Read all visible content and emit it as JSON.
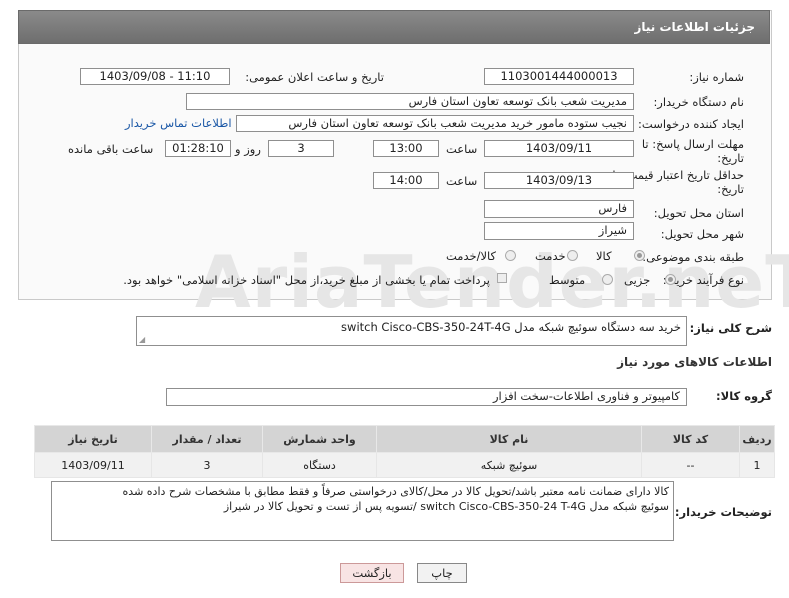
{
  "header": {
    "title": "جزئیات اطلاعات نیاز"
  },
  "form": {
    "need_number": {
      "label": "شماره نیاز:",
      "value": "1103001444000013"
    },
    "announce_datetime": {
      "label": "تاریخ و ساعت اعلان عمومی:",
      "value": "1403/09/08 - 11:10"
    },
    "buyer_org": {
      "label": "نام دستگاه خریدار:",
      "value": "مدیریت شعب بانک توسعه تعاون استان فارس"
    },
    "requester": {
      "label": "ایجاد کننده درخواست:",
      "value": "نجیب ستوده مامور خرید مدیریت شعب بانک توسعه تعاون استان فارس",
      "contact_link": "اطلاعات تماس خریدار"
    },
    "reply_deadline": {
      "label_line1": "مهلت ارسال پاسخ: تا",
      "label_line2": "تاریخ:",
      "date": "1403/09/11",
      "time_label": "ساعت",
      "time": "13:00",
      "days": "3",
      "days_label": "روز و",
      "remaining": "01:28:10",
      "remaining_label": "ساعت باقی مانده"
    },
    "price_validity": {
      "label_line1": "حداقل تاریخ اعتبار قیمت: تا",
      "label_line2": "تاریخ:",
      "date": "1403/09/13",
      "time_label": "ساعت",
      "time": "14:00"
    },
    "delivery_province": {
      "label": "استان محل تحویل:",
      "value": "فارس"
    },
    "delivery_city": {
      "label": "شهر محل تحویل:",
      "value": "شیراز"
    },
    "category": {
      "label": "طبقه بندی موضوعی:",
      "options": [
        "کالا",
        "خدمت",
        "کالا/خدمت"
      ],
      "selected": "کالا"
    },
    "purchase_process": {
      "label": "نوع فرآیند خرید :",
      "options": [
        "جزیی",
        "متوسط"
      ],
      "selected": "جزیی",
      "note": "پرداخت تمام یا بخشی از مبلغ خرید،از محل \"اسناد خزانه اسلامی\" خواهد بود."
    }
  },
  "description": {
    "label": "شرح کلی نیاز:",
    "value": "خرید سه دستگاه سوئیچ شبکه مدل switch Cisco-CBS-350-24T-4G"
  },
  "goods_section": {
    "title": "اطلاعات کالاهای مورد نیاز"
  },
  "goods_group": {
    "label": "گروه کالا:",
    "value": "کامپیوتر و فناوری اطلاعات-سخت افزار"
  },
  "table": {
    "headers": [
      "ردیف",
      "کد کالا",
      "نام کالا",
      "واحد شمارش",
      "تعداد / مقدار",
      "تاریخ نیاز"
    ],
    "rows": [
      [
        "1",
        "--",
        "سوئیچ شبکه",
        "دستگاه",
        "3",
        "1403/09/11"
      ]
    ]
  },
  "buyer_notes": {
    "label": "توضیحات خریدار:",
    "line1": "کالا دارای ضمانت نامه معتبر باشد/تحویل کالا در محل/کالای درخواستی صرفاً و فقط مطابق با مشخصات شرح داده شده",
    "line2": "سوئیچ شبکه مدل switch Cisco-CBS-350-24 T-4G  /تسویه پس از تست و تحویل کالا در شیراز"
  },
  "buttons": {
    "print": "چاپ",
    "back": "بازگشت"
  }
}
